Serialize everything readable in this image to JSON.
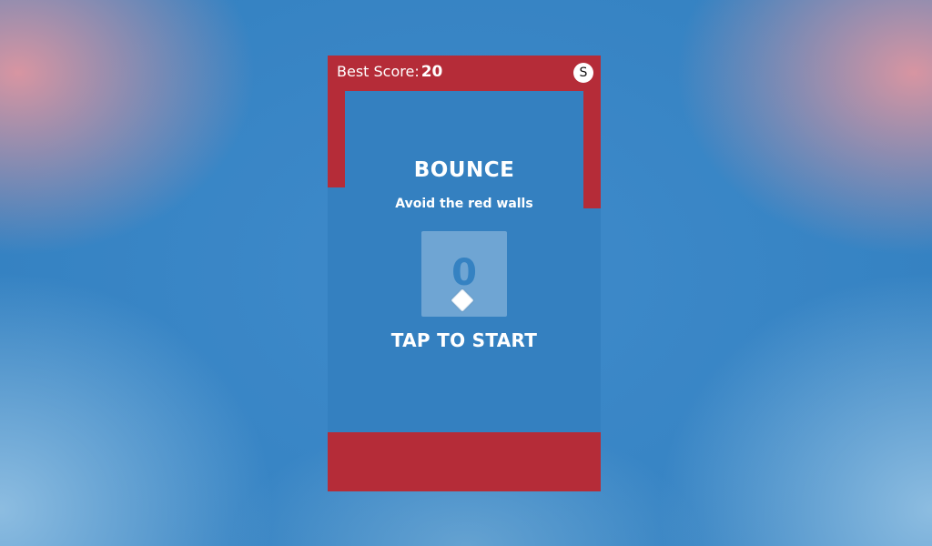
{
  "hud": {
    "best_score_label": "Best Score:",
    "best_score_value": "20",
    "share_label": "S"
  },
  "menu": {
    "title": "BOUNCE",
    "subtitle": "Avoid the red walls",
    "score": "0",
    "start_prompt": "TAP TO START"
  },
  "colors": {
    "background": "#3582c2",
    "wall": "#b52c38",
    "score_box": "#6fa5d3",
    "player": "#ffffff",
    "text": "#ffffff"
  },
  "icons": {
    "share": "share-icon",
    "player": "diamond-player-icon"
  }
}
